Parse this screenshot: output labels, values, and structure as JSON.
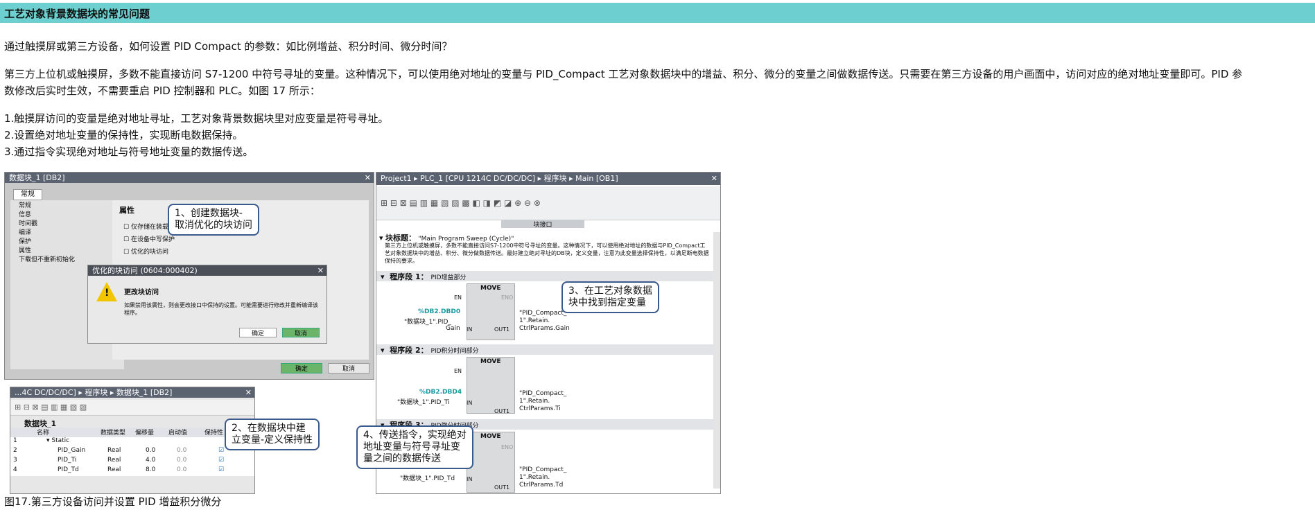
{
  "header": {
    "title": "工艺对象背景数据块的常见问题"
  },
  "paragraphs": {
    "q": "通过触摸屏或第三方设备，如何设置 PID Compact 的参数：如比例增益、积分时间、微分时间？",
    "a1": "第三方上位机或触摸屏，多数不能直接访问 S7-1200 中符号寻址的变量。这种情况下，可以使用绝对地址的变量与 PID_Compact 工艺对象数据块中的增益、积分、微分的变量之间做数据传送。只需要在第三方设备的用户画面中，访问对应的绝对地址变量即可。PID 参",
    "a2": "数修改后实时生效，不需要重启 PID 控制器和 PLC。如图 17 所示：",
    "l1": "1.触摸屏访问的变量是绝对地址寻址，工艺对象背景数据块里对应变量是符号寻址。",
    "l2": "2.设置绝对地址变量的保持性，实现断电数据保持。",
    "l3": "3.通过指令实现绝对地址与符号地址变量的数据传送。"
  },
  "figure": {
    "db_window": {
      "title": "数据块_1 [DB2]",
      "tab": "常规",
      "nav": [
        "常规",
        "信息",
        "时间戳",
        "编译",
        "保护",
        "属性",
        "下载但不重新初始化"
      ],
      "section": "属性",
      "checks": [
        "仅存储在装载",
        "在设备中写保护",
        "优化的块访问"
      ],
      "dialog_title": "优化的块访问 (0604:000402)",
      "dialog_heading": "更改块访问",
      "dialog_text": "如果禁用该属性，则会更改接口中保持的设置。可能需要进行修改并重新编译该程序。",
      "ok": "确定",
      "cancel": "取消",
      "ok2": "确定",
      "cancel2": "取消"
    },
    "db_table": {
      "title": "...4C DC/DC/DC] ▸ 程序块 ▸ 数据块_1 [DB2]",
      "name": "数据块_1",
      "headers": [
        "名称",
        "数据类型",
        "偏移量",
        "启动值",
        "保持性"
      ],
      "static": "Static",
      "rows": [
        {
          "n": "2",
          "name": "PID_Gain",
          "type": "Real",
          "offset": "0.0",
          "start": "0.0"
        },
        {
          "n": "3",
          "name": "PID_Ti",
          "type": "Real",
          "offset": "4.0",
          "start": "0.0"
        },
        {
          "n": "4",
          "name": "PID_Td",
          "type": "Real",
          "offset": "8.0",
          "start": "0.0"
        }
      ]
    },
    "ob_window": {
      "title": "Project1 ▸ PLC_1 [CPU 1214C DC/DC/DC] ▸ 程序块 ▸ Main [OB1]",
      "interface": "块接口",
      "block_title_label": "块标题：",
      "block_title": "\"Main Program Sweep (Cycle)\"",
      "comment": "第三方上位机或触摸屏，多数不能直接访问S7-1200中符号寻址的变量。这种情况下，可以使用绝对地址的数据与PID_Compact工艺对象数据块中的增益、积分、微分做数据传送。最好建立绝对寻址的DB块，定义变量，注意为此变量选择保持性，以满足断电数据保持的要求。",
      "networks": [
        {
          "label": "程序段 1：",
          "title": "PID增益部分",
          "in_addr": "%DB2.DBD0",
          "in_sym1": "\"数据块_1\".PID_",
          "in_sym2": "Gain",
          "out1": "\"PID_Compact_",
          "out2": "1\".Retain.",
          "out3": "CtrlParams.Gain"
        },
        {
          "label": "程序段 2：",
          "title": "PID积分时间部分",
          "in_addr": "%DB2.DBD4",
          "in_sym1": "\"数据块_1\".PID_Ti",
          "in_sym2": "",
          "out1": "\"PID_Compact_",
          "out2": "1\".Retain.",
          "out3": "CtrlParams.Ti"
        },
        {
          "label": "程序段 3：",
          "title": "PID微分时间部分",
          "in_addr": "",
          "in_sym1": "\"数据块_1\".PID_Td",
          "in_sym2": "",
          "out1": "\"PID_Compact_",
          "out2": "1\".Retain.",
          "out3": "CtrlParams.Td"
        }
      ],
      "move": "MOVE",
      "en": "EN",
      "eno": "ENO",
      "in": "IN",
      "out": "OUT1"
    },
    "callouts": {
      "c1a": "1、创建数据块-",
      "c1b": "取消优化的块访问",
      "c2a": "2、在数据块中建",
      "c2b": "立变量-定义保持性",
      "c3a": "3、在工艺对象数据",
      "c3b": "块中找到指定变量",
      "c4a": "4、传送指令，实现绝对",
      "c4b": "地址变量与符号寻址变",
      "c4c": "量之间的数据传送"
    },
    "caption": "图17.第三方设备访问并设置 PID 增益积分微分"
  }
}
